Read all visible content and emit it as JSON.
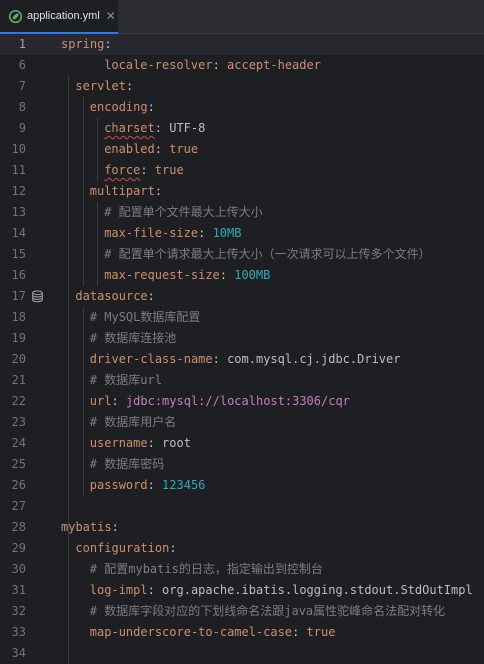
{
  "tab": {
    "label": "application.yml",
    "close": "✕",
    "icon": "spring-leaf-icon"
  },
  "accent": "#3574f0",
  "lines": [
    {
      "n": "1",
      "parts": [
        [
          "key",
          "spring"
        ],
        [
          "punct",
          ":"
        ]
      ]
    },
    {
      "n": "6",
      "parts": [
        [
          "key",
          "locale-resolver"
        ],
        [
          "punct",
          ": "
        ],
        [
          "k",
          "accept-header"
        ]
      ]
    },
    {
      "n": "7",
      "parts": [
        [
          "key",
          "servlet"
        ],
        [
          "punct",
          ":"
        ]
      ]
    },
    {
      "n": "8",
      "parts": [
        [
          "key",
          "encoding"
        ],
        [
          "punct",
          ":"
        ]
      ]
    },
    {
      "n": "9",
      "parts": [
        [
          "key",
          "charset"
        ],
        [
          "punct",
          ": "
        ],
        [
          "plain",
          "UTF-8"
        ]
      ]
    },
    {
      "n": "10",
      "parts": [
        [
          "key",
          "enabled"
        ],
        [
          "punct",
          ": "
        ],
        [
          "k",
          "true"
        ]
      ]
    },
    {
      "n": "11",
      "parts": [
        [
          "key",
          "force"
        ],
        [
          "punct",
          ": "
        ],
        [
          "k",
          "true"
        ]
      ]
    },
    {
      "n": "12",
      "parts": [
        [
          "key",
          "multipart"
        ],
        [
          "punct",
          ":"
        ]
      ]
    },
    {
      "n": "13",
      "parts": [
        [
          "cm",
          "# 配置单个文件最大上传大小"
        ]
      ]
    },
    {
      "n": "14",
      "parts": [
        [
          "key",
          "max-file-size"
        ],
        [
          "punct",
          ": "
        ],
        [
          "num",
          "10MB"
        ]
      ]
    },
    {
      "n": "15",
      "parts": [
        [
          "cm",
          "# 配置单个请求最大上传大小（一次请求可以上传多个文件）"
        ]
      ]
    },
    {
      "n": "16",
      "parts": [
        [
          "key",
          "max-request-size"
        ],
        [
          "punct",
          ": "
        ],
        [
          "num",
          "100MB"
        ]
      ]
    },
    {
      "n": "17",
      "parts": [
        [
          "key",
          "datasource"
        ],
        [
          "punct",
          ":"
        ]
      ],
      "gutter_icon": "database-icon"
    },
    {
      "n": "18",
      "parts": [
        [
          "cm",
          "# MySQL数据库配置"
        ]
      ]
    },
    {
      "n": "19",
      "parts": [
        [
          "cm",
          "# 数据库连接池"
        ]
      ]
    },
    {
      "n": "20",
      "parts": [
        [
          "key",
          "driver-class-name"
        ],
        [
          "punct",
          ": "
        ],
        [
          "plain",
          "com.mysql.cj.jdbc.Driver"
        ]
      ]
    },
    {
      "n": "21",
      "parts": [
        [
          "cm",
          "# 数据库url"
        ]
      ]
    },
    {
      "n": "22",
      "parts": [
        [
          "key",
          "url"
        ],
        [
          "punct",
          ": "
        ],
        [
          "nkey",
          "jdbc:mysql://localhost:3306/cqr"
        ]
      ]
    },
    {
      "n": "23",
      "parts": [
        [
          "cm",
          "# 数据库用户名"
        ]
      ]
    },
    {
      "n": "24",
      "parts": [
        [
          "key",
          "username"
        ],
        [
          "punct",
          ": "
        ],
        [
          "plain",
          "root"
        ]
      ]
    },
    {
      "n": "25",
      "parts": [
        [
          "cm",
          "# 数据库密码"
        ]
      ]
    },
    {
      "n": "26",
      "parts": [
        [
          "key",
          "password"
        ],
        [
          "punct",
          ": "
        ],
        [
          "num",
          "123456"
        ]
      ]
    },
    {
      "n": "27",
      "parts": []
    },
    {
      "n": "28",
      "parts": [
        [
          "key",
          "mybatis"
        ],
        [
          "punct",
          ":"
        ]
      ]
    },
    {
      "n": "29",
      "parts": [
        [
          "key",
          "configuration"
        ],
        [
          "punct",
          ":"
        ]
      ]
    },
    {
      "n": "30",
      "parts": [
        [
          "cm",
          "# 配置mybatis的日志，指定输出到控制台"
        ]
      ]
    },
    {
      "n": "31",
      "parts": [
        [
          "key",
          "log-impl"
        ],
        [
          "punct",
          ": "
        ],
        [
          "plain",
          "org.apache.ibatis.logging.stdout.StdOutImpl"
        ]
      ]
    },
    {
      "n": "32",
      "parts": [
        [
          "cm",
          "# 数据库字段对应的下划线命名法跟java属性驼峰命名法配对转化"
        ]
      ]
    },
    {
      "n": "33",
      "parts": [
        [
          "key",
          "map-underscore-to-camel-case"
        ],
        [
          "punct",
          ": "
        ],
        [
          "k",
          "true"
        ]
      ]
    },
    {
      "n": "34",
      "parts": []
    }
  ]
}
